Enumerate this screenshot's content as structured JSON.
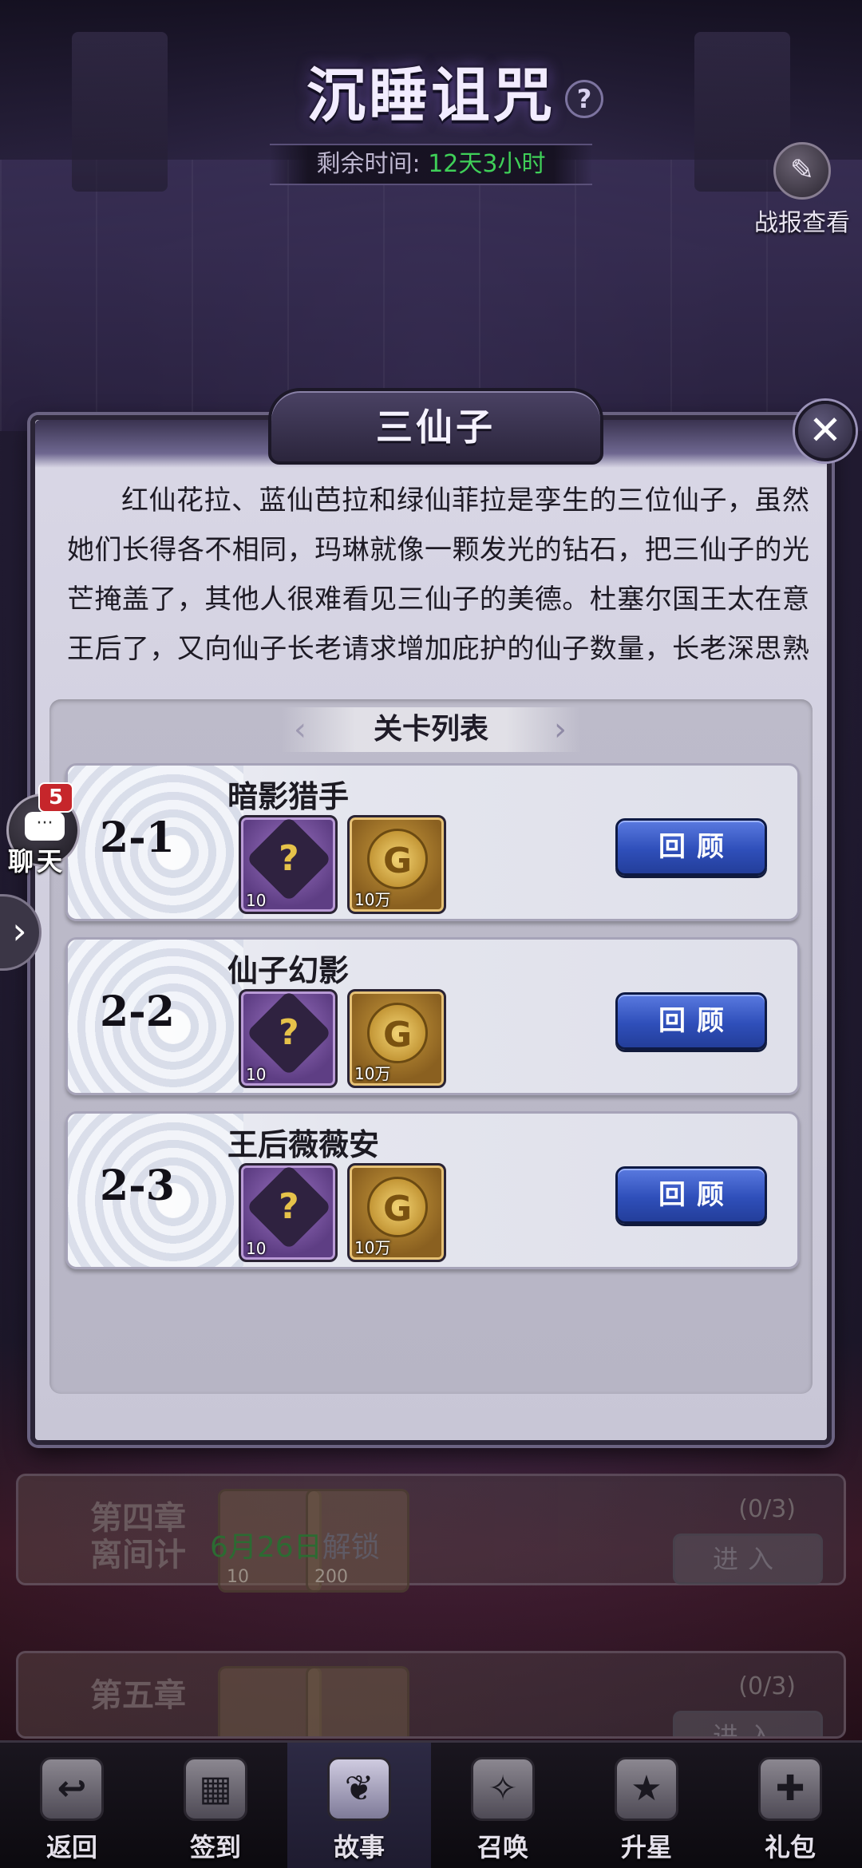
{
  "header": {
    "title": "沉睡诅咒",
    "help_symbol": "?",
    "timer_label": "剩余时间:",
    "timer_value": "12天3小时",
    "battle_report_label": "战报查看"
  },
  "modal": {
    "title": "三仙子",
    "close_symbol": "✕",
    "story": "红仙花拉、蓝仙芭拉和绿仙菲拉是孪生的三位仙子，虽然她们长得各不相同，玛琳就像一颗发光的钻石，把三仙子的光芒掩盖了，其他人很难看见三仙子的美德。杜塞尔国王太在意王后了，又向仙子长老请求增加庇护的仙子数量，长老深思熟虑后，又派出了三仙子，三仙子先来到",
    "stage_list_title": "关卡列表",
    "stages": [
      {
        "num": "2-1",
        "name": "暗影猎手",
        "reward1_qty": "10",
        "reward2_qty": "10万",
        "button": "回顾"
      },
      {
        "num": "2-2",
        "name": "仙子幻影",
        "reward1_qty": "10",
        "reward2_qty": "10万",
        "button": "回顾"
      },
      {
        "num": "2-3",
        "name": "王后薇薇安",
        "reward1_qty": "10",
        "reward2_qty": "10万",
        "button": "回顾"
      }
    ]
  },
  "chapters": [
    {
      "title_line1": "第四章",
      "title_line2": "离间计",
      "unlock_date": "6月26日",
      "unlock_word": "解锁",
      "item1_qty": "10",
      "item2_qty": "200",
      "progress": "(0/3)",
      "enter": "进入"
    },
    {
      "title_line1": "第五章",
      "title_line2": "",
      "unlock_date": "",
      "unlock_word": "",
      "item1_qty": "",
      "item2_qty": "",
      "progress": "(0/3)",
      "enter": "进入"
    }
  ],
  "chat": {
    "badge": "5",
    "label": "聊天",
    "bubble": "···",
    "arrow": "›"
  },
  "nav": [
    {
      "label": "返回",
      "icon_name": "back-icon",
      "glyph": "↩"
    },
    {
      "label": "签到",
      "icon_name": "calendar-icon",
      "glyph": "▦"
    },
    {
      "label": "故事",
      "icon_name": "book-icon",
      "glyph": "❦"
    },
    {
      "label": "召唤",
      "icon_name": "scroll-icon",
      "glyph": "✧"
    },
    {
      "label": "升星",
      "icon_name": "star-badge-icon",
      "glyph": "★"
    },
    {
      "label": "礼包",
      "icon_name": "gift-icon",
      "glyph": "✚"
    }
  ],
  "colors": {
    "accent_green": "#3fcf58",
    "button_blue": "#2f4fba"
  }
}
